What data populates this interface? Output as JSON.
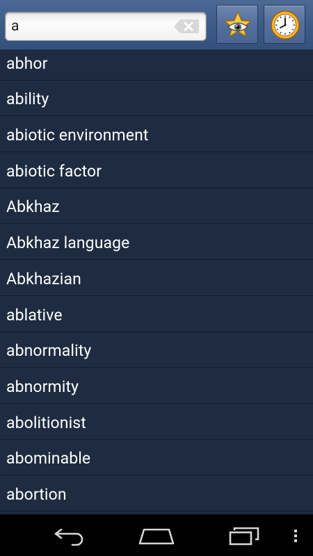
{
  "search": {
    "value": "a",
    "placeholder": ""
  },
  "toolbar": {
    "favorites_icon": "star-eye-icon",
    "history_icon": "clock-icon"
  },
  "words": [
    "abhor",
    "ability",
    "abiotic environment",
    "abiotic factor",
    "Abkhaz",
    "Abkhaz language",
    "Abkhazian",
    "ablative",
    "abnormality",
    "abnormity",
    "abolitionist",
    "abominable",
    "abortion"
  ],
  "navbar": {
    "back_icon": "back-icon",
    "home_icon": "home-icon",
    "recents_icon": "recents-icon",
    "menu_icon": "overflow-menu-icon"
  },
  "colors": {
    "toolbar_top": "#4c6996",
    "list_background": "#1e2b40",
    "row_divider": "#131b29",
    "text": "#ffffff",
    "clock_face": "#f6b52a",
    "star": "#f5c84a"
  }
}
